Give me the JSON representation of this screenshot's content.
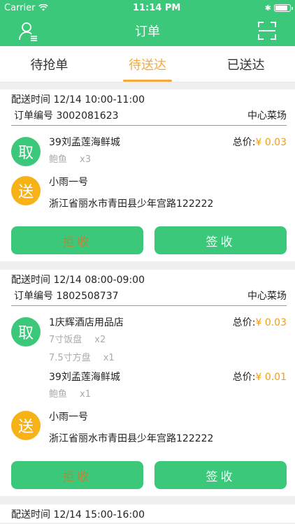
{
  "status_bar": {
    "carrier": "Carrier",
    "time": "11:14 PM",
    "battery_level": 0.85
  },
  "nav": {
    "title": "订单",
    "left_icon": "user-list-icon",
    "right_icon": "scan-icon"
  },
  "tabs": [
    {
      "label": "待抢单",
      "active": false
    },
    {
      "label": "待送达",
      "active": true
    },
    {
      "label": "已送达",
      "active": false
    }
  ],
  "orders": [
    {
      "time": "配送时间 12/14 10:00-11:00",
      "number": "订单编号 3002081623",
      "market": "中心菜场",
      "pickups": [
        {
          "badge": "取",
          "shop": "39刘孟莲海鲜城",
          "price_label": "总价:",
          "price": "¥ 0.03",
          "items": [
            {
              "name": "鲍鱼",
              "qty": "x3"
            }
          ]
        }
      ],
      "deliver": {
        "badge": "送",
        "name": "小雨一号",
        "address": "浙江省丽水市青田县少年宫路122222"
      },
      "reject_label": "拒收",
      "sign_label": "签收"
    },
    {
      "time": "配送时间 12/14 08:00-09:00",
      "number": "订单编号 1802508737",
      "market": "中心菜场",
      "pickups": [
        {
          "badge": "取",
          "shop": "1庆辉酒店用品店",
          "price_label": "总价:",
          "price": "¥ 0.03",
          "items": [
            {
              "name": "7寸饭盘",
              "qty": "x2"
            },
            {
              "name": "7.5寸方盘",
              "qty": "x1"
            }
          ]
        },
        {
          "badge": "",
          "shop": "39刘孟莲海鲜城",
          "price_label": "总价:",
          "price": "¥ 0.01",
          "items": [
            {
              "name": "鲍鱼",
              "qty": "x1"
            }
          ]
        }
      ],
      "deliver": {
        "badge": "送",
        "name": "小雨一号",
        "address": "浙江省丽水市青田县少年宫路122222"
      },
      "reject_label": "拒收",
      "sign_label": "签收"
    },
    {
      "time": "配送时间 12/14 15:00-16:00"
    }
  ]
}
